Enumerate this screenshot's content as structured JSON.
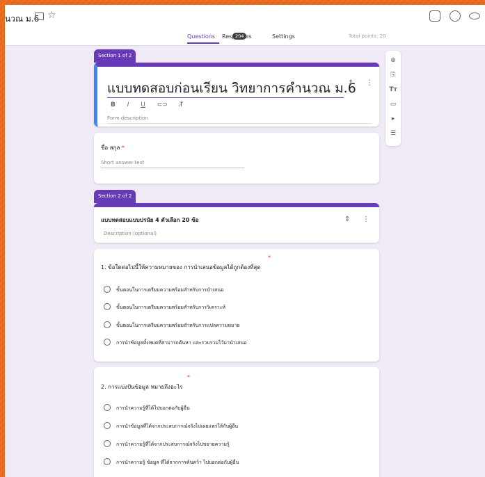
{
  "header": {
    "title": "นวณ ม.6",
    "icons": [
      "folder-icon",
      "star-icon",
      "palette-icon",
      "customize-icon",
      "preview-icon"
    ]
  },
  "tabs": {
    "questions": "Questions",
    "responses": "Responses",
    "responses_count": "204",
    "settings": "Settings",
    "total_points": "Total points: 20"
  },
  "section1": {
    "label": "Section 1 of 2",
    "form_title": "แบบทดสอบก่อนเรียน วิทยาการคำนวณ ม.6",
    "format_buttons": [
      "B",
      "I",
      "U",
      "⊂⊃",
      "T̸"
    ],
    "description_placeholder": "Form description"
  },
  "name_question": {
    "label": "ชื่อ สกุล",
    "required_mark": "*",
    "answer_placeholder": "Short answer text"
  },
  "section2": {
    "label": "Section 2 of 2",
    "title": "แบบทดสอบแบบปรนัย 4 ตัวเลือก 20 ข้อ",
    "description_placeholder": "Description (optional)"
  },
  "questions": [
    {
      "label": "1. ข้อใดต่อไปนี้ให้ความหมายของ การนำเสนอข้อมูลได้ถูกต้องที่สุด",
      "required_mark": "*",
      "options": [
        "ขั้นตอนในการเตรียมความพร้อมสำหรับการนำเสนอ",
        "ขั้นตอนในการเตรียมความพร้อมสำหรับการวิเคราะห์",
        "ขั้นตอนในการเตรียมความพร้อมสำหรับการแปลความหมาย",
        "การนำข้อมูลทั้งหมดที่สามารถค้นหา และรวบรวมไว้มานำเสนอ"
      ]
    },
    {
      "label": "2. การแบ่งปันข้อมูล หมายถึงอะไร",
      "required_mark": "*",
      "options": [
        "การนำความรู้ที่ได้ไปบอกต่อกับผู้อื่น",
        "การนำข้อมูลที่ได้จากประสบการณ์จริงไปเผยแพร่ให้กับผู้อื่น",
        "การนำความรู้ที่ได้จากประสบการณ์จริงไปขยายความรู้",
        "การนำความรู้ ข้อมูล ที่ได้จากการค้นคว้า ไปบอกต่อกับผู้อื่น"
      ]
    }
  ],
  "colors": {
    "accent": "#673ab7",
    "background": "#efeaf6",
    "border_orange": "#e86a1c",
    "focus_blue": "#4285f4",
    "required_red": "#d93025"
  }
}
